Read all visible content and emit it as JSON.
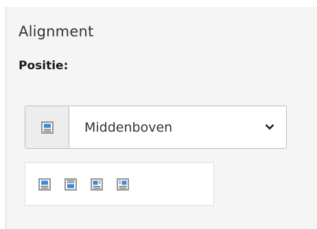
{
  "section": {
    "title": "Alignment"
  },
  "field": {
    "label": "Positie:"
  },
  "select": {
    "addon_icon": "image-position-center-top-icon",
    "value": "Middenboven",
    "chevron_icon": "chevron-down-icon"
  },
  "position_icons": [
    {
      "name": "position-center-top-icon"
    },
    {
      "name": "position-center-bottom-icon"
    },
    {
      "name": "position-top-right-icon"
    },
    {
      "name": "position-top-left-icon"
    }
  ],
  "colors": {
    "accent_blue": "#3c8ad6",
    "icon_gray": "#707070",
    "panel_bg": "#f5f5f5"
  }
}
